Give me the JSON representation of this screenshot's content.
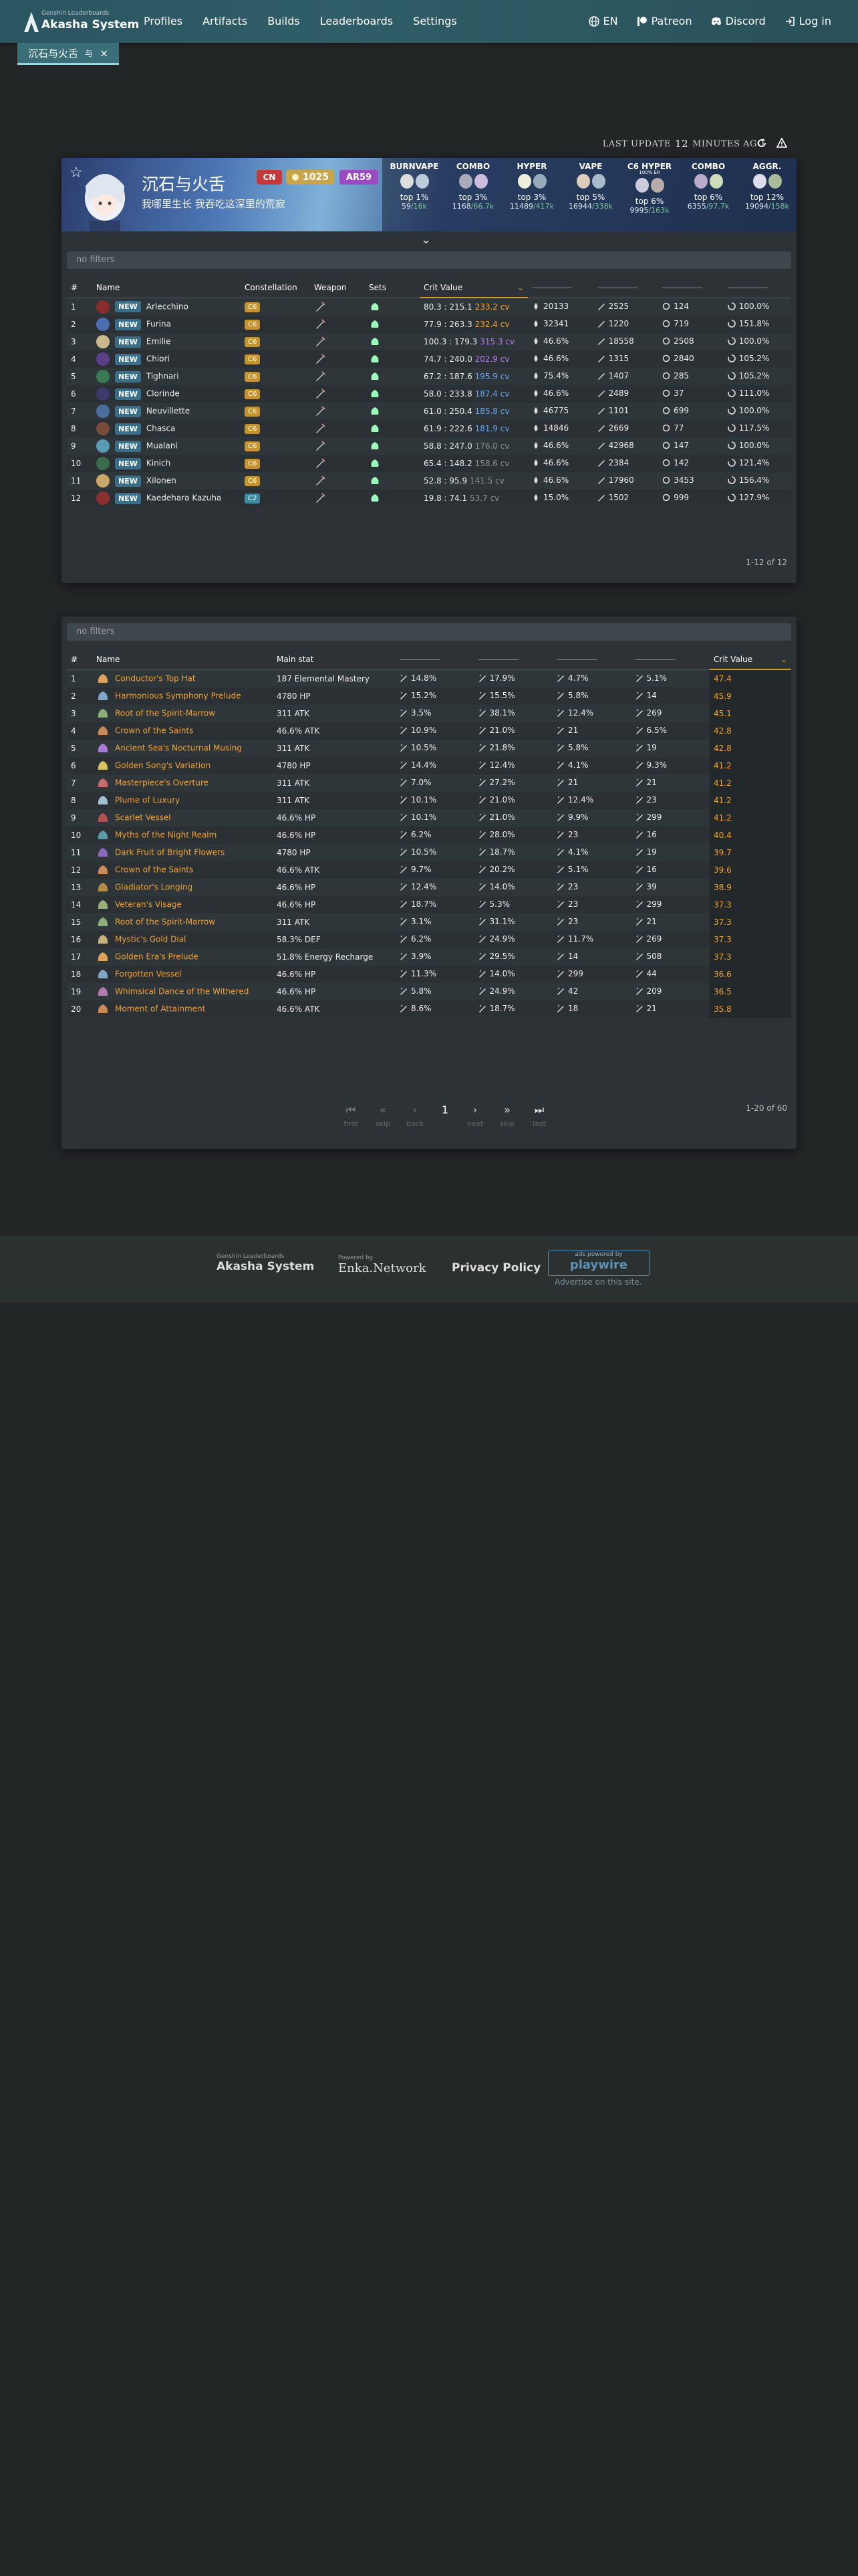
{
  "brand": {
    "sub": "Genshin Leaderboards",
    "name": "Akasha System"
  },
  "nav": {
    "links": [
      "Profiles",
      "Artifacts",
      "Builds",
      "Leaderboards",
      "Settings"
    ],
    "lang": "EN",
    "patreon": "Patreon",
    "discord": "Discord",
    "login": "Log in"
  },
  "tab": {
    "label": "沉石与火舌",
    "suffix": "与",
    "close": "×"
  },
  "last_update": {
    "prefix": "LAST UPDATE",
    "value": "12",
    "suffix": "MINUTES AGO"
  },
  "profile": {
    "name": "沉石与火舌",
    "signature": "我哪里生长 我吞吃这深里的荒寂",
    "region": "CN",
    "achievements": "1025",
    "ar": "AR59"
  },
  "leaderboards": [
    {
      "title": "BURNVAPE",
      "sub": "",
      "top": "top 1%",
      "rank": "59",
      "total": "/16k",
      "pct": "%"
    },
    {
      "title": "COMBO",
      "sub": "",
      "top": "top 3%",
      "rank": "1168",
      "total": "/66.7k",
      "pct": ""
    },
    {
      "title": "HYPER",
      "sub": "",
      "top": "top 3%",
      "rank": "11489",
      "total": "/417k",
      "pct": ""
    },
    {
      "title": "VAPE",
      "sub": "",
      "top": "top 5%",
      "rank": "16944",
      "total": "/338k",
      "pct": ""
    },
    {
      "title": "C6 HYPER",
      "sub": "100% ER",
      "top": "top 6%",
      "rank": "9995",
      "total": "/163k",
      "pct": ""
    },
    {
      "title": "COMBO",
      "sub": "",
      "top": "top 6%",
      "rank": "6355",
      "total": "/97.7k",
      "pct": ""
    },
    {
      "title": "AGGR.",
      "sub": "",
      "top": "top 12%",
      "rank": "19094",
      "total": "/158k",
      "pct": ""
    }
  ],
  "filters": {
    "placeholder": "no filters"
  },
  "char_table": {
    "headers": [
      "#",
      "Name",
      "Constellation",
      "Weapon",
      "Sets",
      "Crit Value"
    ],
    "rows": [
      {
        "n": "1",
        "name": "Arlecchino",
        "c": "C6",
        "cr": "80.3 : 215.1",
        "cv": "233.2 cv",
        "cvc": "orange",
        "s1": "20133",
        "s2": "2525",
        "s3": "124",
        "s4": "100.0%",
        "av": "#8b2c2c"
      },
      {
        "n": "2",
        "name": "Furina",
        "c": "C6",
        "cr": "77.9 : 263.3",
        "cv": "232.4 cv",
        "cvc": "orange",
        "s1": "32341",
        "s2": "1220",
        "s3": "719",
        "s4": "151.8%",
        "av": "#4a6fb0"
      },
      {
        "n": "3",
        "name": "Emilie",
        "c": "C6",
        "cr": "100.3 : 179.3",
        "cv": "315.3 cv",
        "cvc": "purple",
        "s1": "46.6%",
        "s2": "18558",
        "s3": "2508",
        "s4": "100.0%",
        "av": "#c9b98b"
      },
      {
        "n": "4",
        "name": "Chiori",
        "c": "C6",
        "cr": "74.7 : 240.0",
        "cv": "202.9 cv",
        "cvc": "purple",
        "s1": "46.6%",
        "s2": "1315",
        "s3": "2840",
        "s4": "105.2%",
        "av": "#5a3f86"
      },
      {
        "n": "5",
        "name": "Tighnari",
        "c": "C6",
        "cr": "67.2 : 187.6",
        "cv": "195.9 cv",
        "cvc": "blue",
        "s1": "75.4%",
        "s2": "1407",
        "s3": "285",
        "s4": "105.2%",
        "av": "#3a7a55"
      },
      {
        "n": "6",
        "name": "Clorinde",
        "c": "C6",
        "cr": "58.0 : 233.8",
        "cv": "187.4 cv",
        "cvc": "blue",
        "s1": "46.6%",
        "s2": "2489",
        "s3": "37",
        "s4": "111.0%",
        "av": "#3b3a6a"
      },
      {
        "n": "7",
        "name": "Neuvillette",
        "c": "C6",
        "cr": "61.0 : 250.4",
        "cv": "185.8 cv",
        "cvc": "blue",
        "s1": "46775",
        "s2": "1101",
        "s3": "699",
        "s4": "100.0%",
        "av": "#4a6f9e"
      },
      {
        "n": "8",
        "name": "Chasca",
        "c": "C6",
        "cr": "61.9 : 222.6",
        "cv": "181.9 cv",
        "cvc": "blue",
        "s1": "14846",
        "s2": "2669",
        "s3": "77",
        "s4": "117.5%",
        "av": "#7a4a3a"
      },
      {
        "n": "9",
        "name": "Mualani",
        "c": "C6",
        "cr": "58.8 : 247.0",
        "cv": "176.0 cv",
        "cvc": "gray",
        "s1": "46.6%",
        "s2": "42968",
        "s3": "147",
        "s4": "100.0%",
        "av": "#5a9ab5"
      },
      {
        "n": "10",
        "name": "Kinich",
        "c": "C6",
        "cr": "65.4 : 148.2",
        "cv": "158.6 cv",
        "cvc": "gray",
        "s1": "46.6%",
        "s2": "2384",
        "s3": "142",
        "s4": "121.4%",
        "av": "#3a6b4a"
      },
      {
        "n": "11",
        "name": "Xilonen",
        "c": "C6",
        "cr": "52.8 : 95.9",
        "cv": "141.5 cv",
        "cvc": "gray",
        "s1": "46.6%",
        "s2": "17960",
        "s3": "3453",
        "s4": "156.4%",
        "av": "#c8a86a"
      },
      {
        "n": "12",
        "name": "Kaedehara Kazuha",
        "c": "C2",
        "cr": "19.8 : 74.1",
        "cv": "53.7 cv",
        "cvc": "gray",
        "s1": "15.0%",
        "s2": "1502",
        "s3": "999",
        "s4": "127.9%",
        "av": "#8a3030"
      }
    ],
    "pagination": "1-12 of 12"
  },
  "art_table": {
    "headers": [
      "#",
      "Name",
      "Main stat",
      "Crit Value"
    ],
    "rows": [
      {
        "n": "1",
        "name": "Conductor's Top Hat",
        "main": "187 Elemental Mastery",
        "s": [
          "14.8%",
          "17.9%",
          "4.7%",
          "5.1%"
        ],
        "cv": "47.4"
      },
      {
        "n": "2",
        "name": "Harmonious Symphony Prelude",
        "main": "4780 HP",
        "s": [
          "15.2%",
          "15.5%",
          "5.8%",
          "14"
        ],
        "cv": "45.9"
      },
      {
        "n": "3",
        "name": "Root of the Spirit-Marrow",
        "main": "311 ATK",
        "s": [
          "3.5%",
          "38.1%",
          "12.4%",
          "269"
        ],
        "cv": "45.1"
      },
      {
        "n": "4",
        "name": "Crown of the Saints",
        "main": "46.6% ATK",
        "s": [
          "10.9%",
          "21.0%",
          "21",
          "6.5%"
        ],
        "cv": "42.8"
      },
      {
        "n": "5",
        "name": "Ancient Sea's Nocturnal Musing",
        "main": "311 ATK",
        "s": [
          "10.5%",
          "21.8%",
          "5.8%",
          "19"
        ],
        "cv": "42.8"
      },
      {
        "n": "6",
        "name": "Golden Song's Variation",
        "main": "4780 HP",
        "s": [
          "14.4%",
          "12.4%",
          "4.1%",
          "9.3%"
        ],
        "cv": "41.2"
      },
      {
        "n": "7",
        "name": "Masterpiece's Overture",
        "main": "311 ATK",
        "s": [
          "7.0%",
          "27.2%",
          "21",
          "21"
        ],
        "cv": "41.2"
      },
      {
        "n": "8",
        "name": "Plume of Luxury",
        "main": "311 ATK",
        "s": [
          "10.1%",
          "21.0%",
          "12.4%",
          "23"
        ],
        "cv": "41.2"
      },
      {
        "n": "9",
        "name": "Scarlet Vessel",
        "main": "46.6% HP",
        "s": [
          "10.1%",
          "21.0%",
          "9.9%",
          "299"
        ],
        "cv": "41.2"
      },
      {
        "n": "10",
        "name": "Myths of the Night Realm",
        "main": "46.6% HP",
        "s": [
          "6.2%",
          "28.0%",
          "23",
          "16"
        ],
        "cv": "40.4"
      },
      {
        "n": "11",
        "name": "Dark Fruit of Bright Flowers",
        "main": "4780 HP",
        "s": [
          "10.5%",
          "18.7%",
          "4.1%",
          "19"
        ],
        "cv": "39.7"
      },
      {
        "n": "12",
        "name": "Crown of the Saints",
        "main": "46.6% ATK",
        "s": [
          "9.7%",
          "20.2%",
          "5.1%",
          "16"
        ],
        "cv": "39.6"
      },
      {
        "n": "13",
        "name": "Gladiator's Longing",
        "main": "46.6% HP",
        "s": [
          "12.4%",
          "14.0%",
          "23",
          "39"
        ],
        "cv": "38.9"
      },
      {
        "n": "14",
        "name": "Veteran's Visage",
        "main": "46.6% HP",
        "s": [
          "18.7%",
          "5.3%",
          "23",
          "299"
        ],
        "cv": "37.3"
      },
      {
        "n": "15",
        "name": "Root of the Spirit-Marrow",
        "main": "311 ATK",
        "s": [
          "3.1%",
          "31.1%",
          "23",
          "21"
        ],
        "cv": "37.3"
      },
      {
        "n": "16",
        "name": "Mystic's Gold Dial",
        "main": "58.3% DEF",
        "s": [
          "6.2%",
          "24.9%",
          "11.7%",
          "269"
        ],
        "cv": "37.3"
      },
      {
        "n": "17",
        "name": "Golden Era's Prelude",
        "main": "51.8% Energy Recharge",
        "s": [
          "3.9%",
          "29.5%",
          "14",
          "508"
        ],
        "cv": "37.3"
      },
      {
        "n": "18",
        "name": "Forgotten Vessel",
        "main": "46.6% HP",
        "s": [
          "11.3%",
          "14.0%",
          "299",
          "44"
        ],
        "cv": "36.6"
      },
      {
        "n": "19",
        "name": "Whimsical Dance of the Withered",
        "main": "46.6% HP",
        "s": [
          "5.8%",
          "24.9%",
          "42",
          "209"
        ],
        "cv": "36.5"
      },
      {
        "n": "20",
        "name": "Moment of Attainment",
        "main": "46.6% ATK",
        "s": [
          "8.6%",
          "18.7%",
          "18",
          "21"
        ],
        "cv": "35.8"
      }
    ],
    "pagination": "1-20 of 60",
    "pager": {
      "page": "1",
      "first": "first",
      "skip_back": "skip",
      "back": "back",
      "next": "next",
      "skip_fwd": "skip",
      "last": "last"
    }
  },
  "footer": {
    "akasha_sub": "Genshin Leaderboards",
    "akasha": "Akasha System",
    "enka_sub": "Powered by",
    "enka": "Enka.Network",
    "privacy": "Privacy Policy",
    "pw_sub": "ads powered by",
    "pw": "playwire",
    "advertise": "Advertise on this site."
  }
}
